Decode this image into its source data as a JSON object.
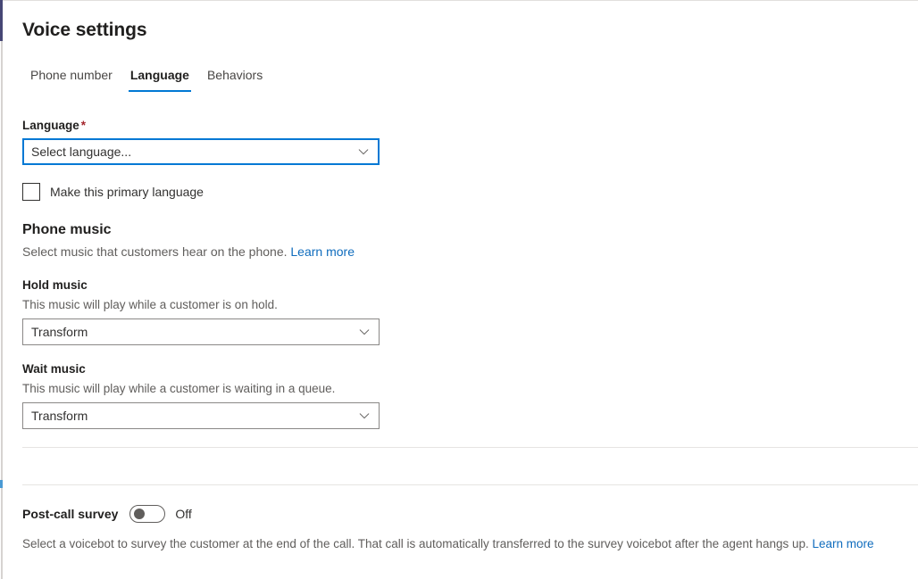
{
  "header": {
    "title": "Voice settings"
  },
  "tabs": [
    {
      "label": "Phone number",
      "active": false
    },
    {
      "label": "Language",
      "active": true
    },
    {
      "label": "Behaviors",
      "active": false
    }
  ],
  "language_section": {
    "label": "Language",
    "required_marker": "*",
    "dropdown": {
      "value": "Select language...",
      "chevron_icon": "chevron-down-icon",
      "focused": true
    },
    "checkbox": {
      "label": "Make this primary language",
      "checked": false
    }
  },
  "phone_music": {
    "heading": "Phone music",
    "description": "Select music that customers hear on the phone.",
    "learn_more": "Learn more",
    "hold_music": {
      "label": "Hold music",
      "description": "This music will play while a customer is on hold.",
      "value": "Transform",
      "chevron_icon": "chevron-down-icon"
    },
    "wait_music": {
      "label": "Wait music",
      "description": "This music will play while a customer is waiting in a queue.",
      "value": "Transform",
      "chevron_icon": "chevron-down-icon"
    }
  },
  "post_call_survey": {
    "label": "Post-call survey",
    "toggle_state": "Off",
    "enabled": false,
    "description": "Select a voicebot to survey the customer at the end of the call. That call is automatically transferred to the survey voicebot after the agent hangs up.",
    "learn_more": "Learn more"
  },
  "colors": {
    "accent": "#0078d4",
    "link": "#0f6cbd",
    "required": "#a4262c",
    "rail_dark": "#464775"
  }
}
